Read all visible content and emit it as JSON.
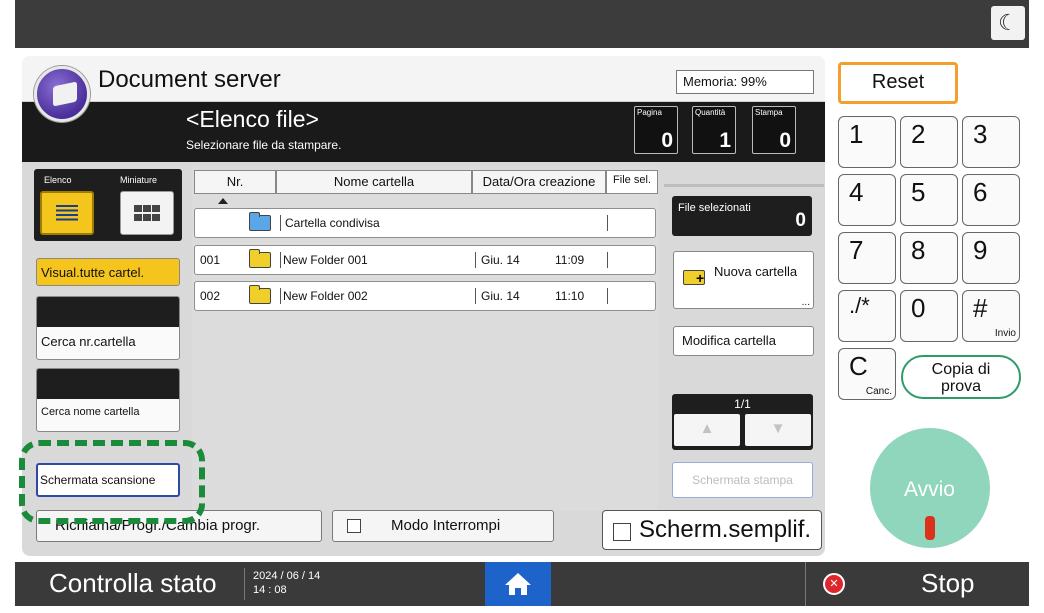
{
  "header": {
    "title": "Document server",
    "memory": "Memoria:   99%"
  },
  "list": {
    "title": "<Elenco file>",
    "subtitle": "Selezionare file da stampare."
  },
  "counters": [
    {
      "label": "Pagina",
      "value": "0"
    },
    {
      "label": "Quantità",
      "value": "1"
    },
    {
      "label": "Stampa",
      "value": "0"
    }
  ],
  "view": {
    "list_label": "Elenco",
    "thumb_label": "Miniature"
  },
  "sidebar": {
    "visual_all": "Visual.tutte cartel.",
    "search_number": "Cerca nr.cartella",
    "search_name": "Cerca nome cartella",
    "scan_screen": "Schermata scansione"
  },
  "table": {
    "columns": [
      "Nr.",
      "Nome cartella",
      "Data/Ora creazione",
      "File sel."
    ],
    "shared": {
      "name": "Cartella condivisa"
    },
    "rows": [
      {
        "nr": "001",
        "name": "New Folder 001",
        "date": "Giu. 14",
        "time": "11:09"
      },
      {
        "nr": "002",
        "name": "New Folder 002",
        "date": "Giu. 14",
        "time": "11:10"
      }
    ]
  },
  "right": {
    "selected_label": "File selezionati",
    "selected_count": "0",
    "new_folder": "Nuova cartella",
    "modify_folder": "Modifica cartella",
    "page": "1/1",
    "print_screen": "Schermata stampa"
  },
  "bottom": {
    "recall": "Richiama/Progr./Cambia progr.",
    "interrupt": "Modo Interrompi",
    "simplified": "Scherm.semplif."
  },
  "keypad": {
    "reset": "Reset",
    "keys": [
      "1",
      "2",
      "3",
      "4",
      "5",
      "6",
      "7",
      "8",
      "9",
      "./*",
      "0",
      "#"
    ],
    "enter_sub": "Invio",
    "clear": "C",
    "clear_sub": "Canc.",
    "proof_copy_line1": "Copia di",
    "proof_copy_line2": "prova",
    "start": "Avvio"
  },
  "statusbar": {
    "check_status": "Controlla stato",
    "date": "2024 / 06 / 14",
    "time": "14 : 08",
    "stop": "Stop"
  },
  "colors": {
    "accent_yellow": "#f5c51e",
    "highlight_green": "#1a8a3b",
    "home_blue": "#1e63c9",
    "reset_orange": "#f29f2e"
  },
  "icons": [
    "moon-icon",
    "document-server-icon",
    "list-view-icon",
    "thumbnail-view-icon",
    "folder-icon",
    "new-folder-icon",
    "home-icon",
    "stop-icon"
  ]
}
